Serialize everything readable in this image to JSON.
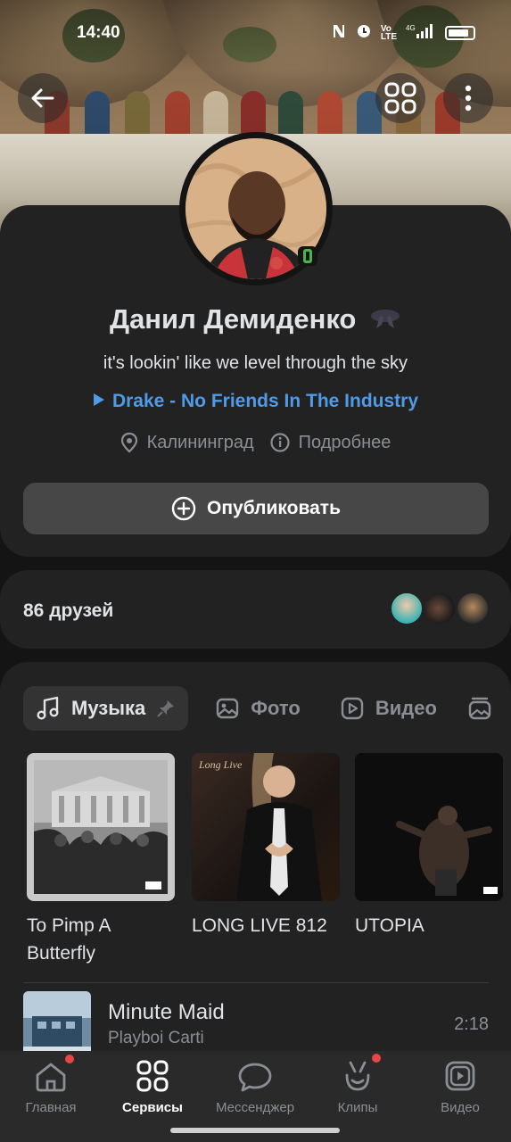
{
  "status_bar": {
    "time": "14:40"
  },
  "profile": {
    "name": "Данил Демиденко",
    "status": "it's lookin' like we level through the sky",
    "now_playing": "Drake - No Friends In The Industry",
    "city": "Калининград",
    "more_info": "Подробнее",
    "publish_label": "Опубликовать"
  },
  "friends": {
    "label": "86 друзей"
  },
  "media": {
    "tabs": [
      {
        "label": "Музыка",
        "icon": "music-note-icon",
        "active": true
      },
      {
        "label": "Фото",
        "icon": "photo-icon",
        "active": false
      },
      {
        "label": "Видео",
        "icon": "video-play-icon",
        "active": false
      }
    ],
    "albums": [
      {
        "title": "To Pimp A Butterfly"
      },
      {
        "title": "LONG LIVE 812",
        "cover_text": "Long Live"
      },
      {
        "title": "UTOPIA"
      }
    ],
    "songs": [
      {
        "title": "Minute Maid",
        "artist": "Playboi Carti",
        "duration": "2:18"
      }
    ]
  },
  "bottom_nav": [
    {
      "label": "Главная",
      "icon": "home-icon",
      "badge": true
    },
    {
      "label": "Сервисы",
      "icon": "services-grid-icon",
      "active": true
    },
    {
      "label": "Мессенджер",
      "icon": "chat-bubble-icon"
    },
    {
      "label": "Клипы",
      "icon": "clips-icon",
      "badge": true
    },
    {
      "label": "Видео",
      "icon": "video-icon"
    }
  ],
  "colors": {
    "accent": "#4f9be8",
    "online": "#4bb34b",
    "badge": "#e64646",
    "card": "#222222"
  }
}
